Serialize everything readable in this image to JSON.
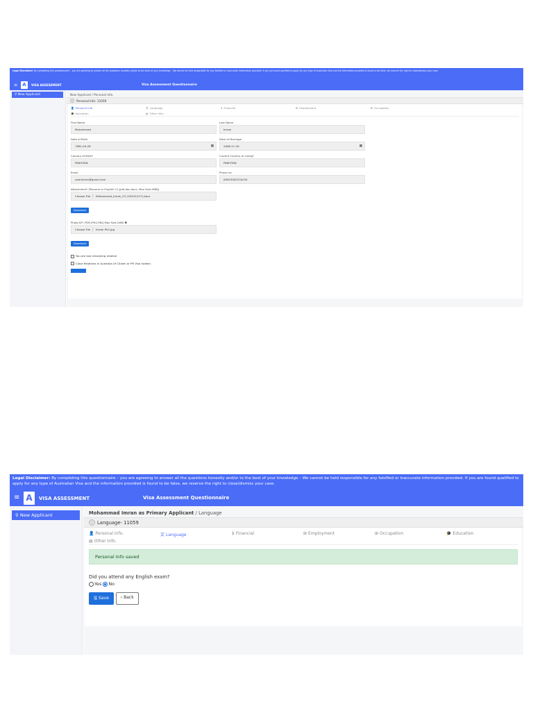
{
  "disclaimer": {
    "label": "Legal Disclaimer:",
    "text": " By completing this questionnaire – you are agreeing to answer all the questions honestly and/or to the best of your knowledge – We cannot be held responsible for any falsified or inaccurate information provided. If you are found qualified to apply for any type of Australian Visa and the information provided is found to be false, we reserve the right to close/dismiss your case."
  },
  "header": {
    "brand": "VISA ASSESSMENT",
    "logo_glyph": "A",
    "menu_glyph": "≡",
    "title": "Visa Assessment Questionnaire"
  },
  "sidebar": {
    "new_applicant": "New Applicant",
    "icon_glyph": "⚲"
  },
  "tabs": [
    {
      "label": "Personal Info.",
      "icon": "person-icon",
      "glyph": "👤"
    },
    {
      "label": "Language",
      "icon": "translate-icon",
      "glyph": "文"
    },
    {
      "label": "Financial",
      "icon": "money-icon",
      "glyph": "$"
    },
    {
      "label": "Employment",
      "icon": "briefcase-icon",
      "glyph": "⊞"
    },
    {
      "label": "Occupation",
      "icon": "building-icon",
      "glyph": "⊞"
    },
    {
      "label": "Education",
      "icon": "graduation-cap-icon",
      "glyph": "🎓"
    },
    {
      "label": "Other Info.",
      "icon": "list-icon",
      "glyph": "▤"
    }
  ],
  "screen1": {
    "breadcrumb_root": "New Applicant",
    "breadcrumb_sep": " / ",
    "breadcrumb_current": "Personal Info.",
    "step_title": "Personal Info- 11059",
    "active_tab": 0,
    "fields": [
      {
        "label": "First Name",
        "value": "Mohammad"
      },
      {
        "label": "Last Name",
        "value": "Imran"
      },
      {
        "label": "Date of Birth",
        "value": "1981-04-28",
        "calendar": true
      },
      {
        "label": "Date of Marriage",
        "value": "2008-11-30",
        "calendar": true
      },
      {
        "label": "Country of Birth*",
        "value": "PAKISTAN"
      },
      {
        "label": "Current Country of Living*",
        "value": "PAKISTAN"
      },
      {
        "label": "Email",
        "value": "yaarimran@gmail.com"
      },
      {
        "label": "Phone no",
        "value": "00923002234234"
      }
    ],
    "attachment": {
      "label": "Attachment* (Resume or English CV,[pdf,doc,docx, Max Size:4MB])",
      "button": "Choose File",
      "filename": "Mohammad_Imran_CV (20241227).docx",
      "download": "Download"
    },
    "photo": {
      "label": "Photo ID* (PDF,JPEG,PNG,Max Size:1MB)",
      "info_glyph": "❶",
      "button": "Choose File",
      "filename": "Imran Pk2.jpg",
      "download": "Download"
    },
    "checkboxes": [
      "You are last remaining relative",
      "Close Relatives in Australia (If Citizen or PR Visa holder)"
    ]
  },
  "screen2": {
    "breadcrumb_root": "Mohammad Imran as Primary Applicant",
    "breadcrumb_sep": " / ",
    "breadcrumb_current": "Language",
    "step_title": "Language- 11059",
    "active_tab": 1,
    "alert": "Personal Info saved",
    "question": "Did you attend any English exam?",
    "options": [
      {
        "label": "Yes",
        "selected": false
      },
      {
        "label": "No",
        "selected": true
      }
    ],
    "save_label": "Save",
    "save_glyph": "🖫",
    "back_label": "Back",
    "back_glyph": "‹"
  }
}
